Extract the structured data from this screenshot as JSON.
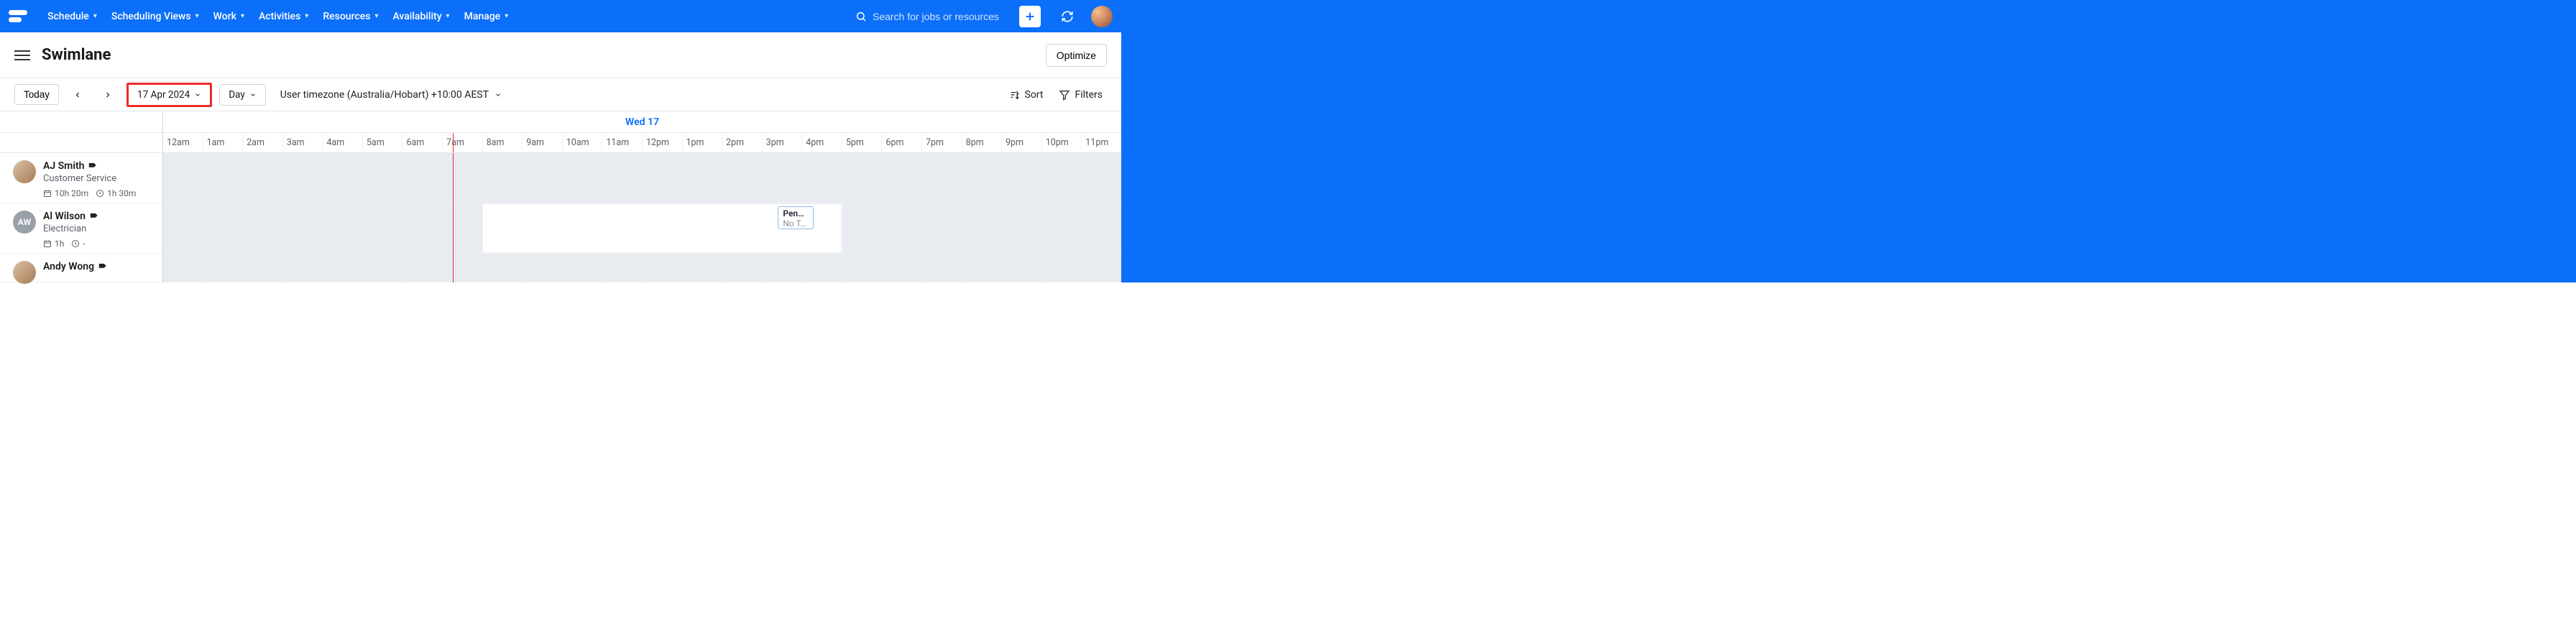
{
  "nav": {
    "items": [
      {
        "label": "Schedule"
      },
      {
        "label": "Scheduling Views"
      },
      {
        "label": "Work"
      },
      {
        "label": "Activities"
      },
      {
        "label": "Resources"
      },
      {
        "label": "Availability"
      },
      {
        "label": "Manage"
      }
    ],
    "search_placeholder": "Search for jobs or resources"
  },
  "header": {
    "title": "Swimlane",
    "optimize": "Optimize"
  },
  "toolbar": {
    "today": "Today",
    "date": "17 Apr 2024",
    "view": "Day",
    "timezone": "User timezone (Australia/Hobart) +10:00 AEST",
    "sort": "Sort",
    "filters": "Filters"
  },
  "calendar": {
    "day_label": "Wed 17",
    "hours": [
      "12am",
      "1am",
      "2am",
      "3am",
      "4am",
      "5am",
      "6am",
      "7am",
      "8am",
      "9am",
      "10am",
      "11am",
      "12pm",
      "1pm",
      "2pm",
      "3pm",
      "4pm",
      "5pm",
      "6pm",
      "7pm",
      "8pm",
      "9pm",
      "10pm",
      "11pm"
    ],
    "now_hour_fraction": 7.25,
    "resources": [
      {
        "name": "AJ Smith",
        "role": "Customer Service",
        "meta_work": "10h 20m",
        "meta_break": "1h 30m",
        "avatar_initials": "",
        "avail": null,
        "jobs": []
      },
      {
        "name": "Al Wilson",
        "role": "Electrician",
        "meta_work": "1h",
        "meta_break": "-",
        "avatar_initials": "AW",
        "avail": {
          "start_h": 8.0,
          "end_h": 17.0
        },
        "jobs": [
          {
            "start_h": 15.4,
            "end_h": 16.3,
            "title": "Pend…",
            "sub": "No T…"
          }
        ]
      },
      {
        "name": "Andy Wong",
        "role": "",
        "meta_work": "",
        "meta_break": "",
        "avatar_initials": "",
        "avail": null,
        "jobs": [],
        "short": true
      }
    ]
  }
}
